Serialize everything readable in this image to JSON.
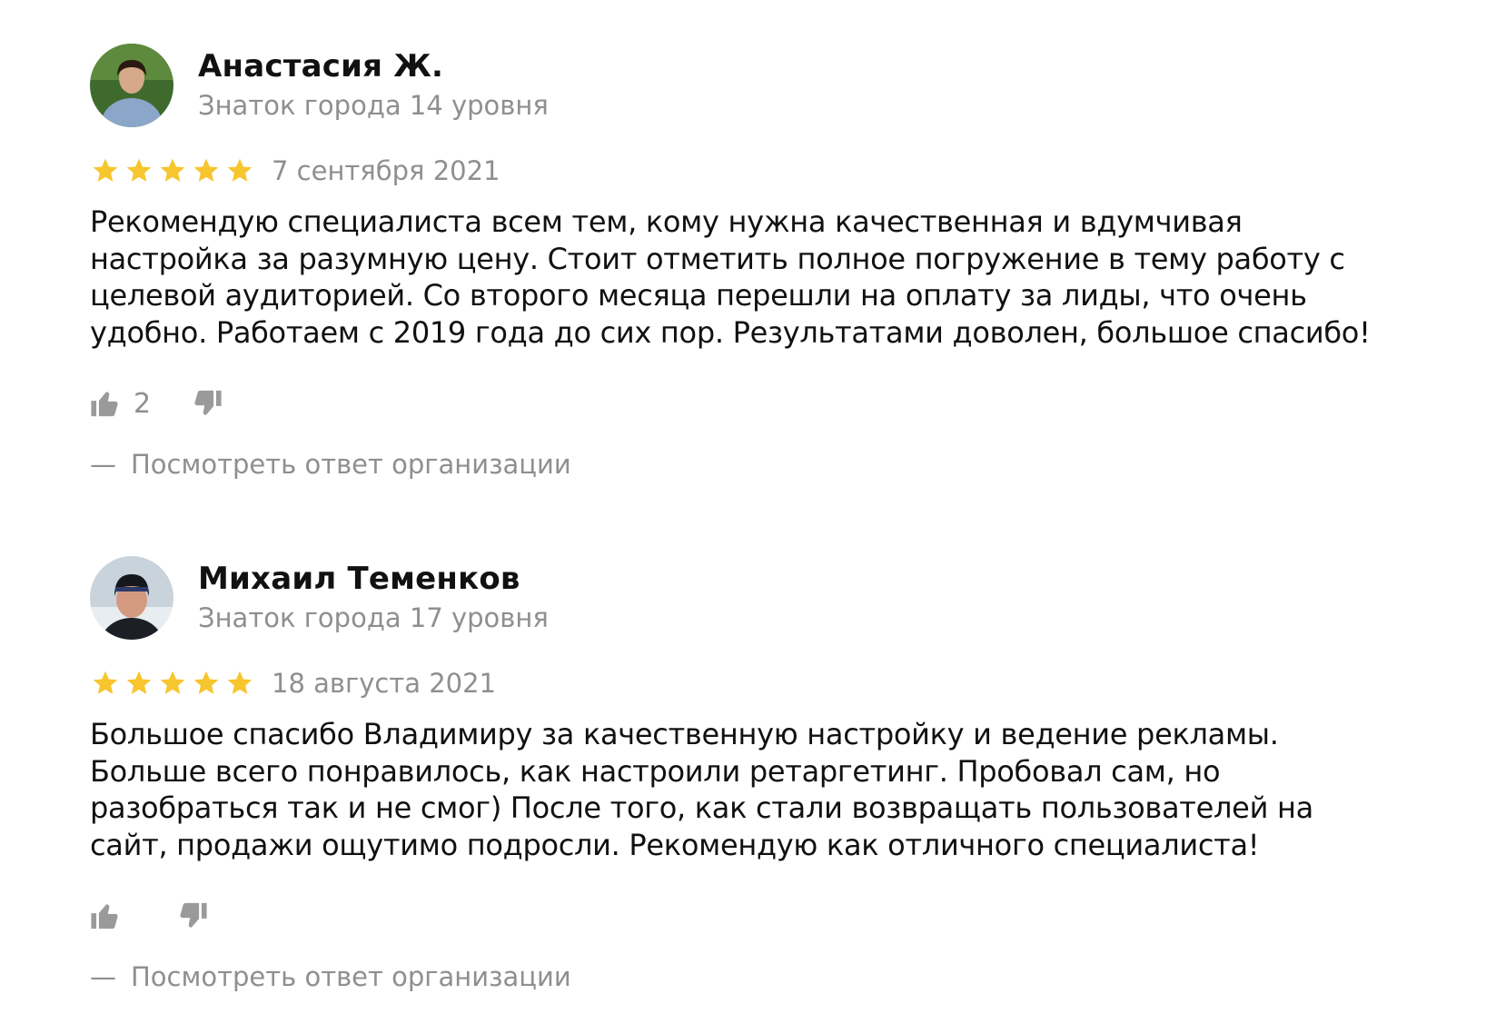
{
  "reviews": [
    {
      "author": "Анастасия Ж.",
      "level": "Знаток города 14 уровня",
      "rating": 5,
      "date": "7 сентября 2021",
      "text": "Рекомендую специалиста всем тем, кому нужна качественная и вдумчивая\nнастройка за разумную цену. Стоит отметить полное погружение в тему работу с\nцелевой аудиторией. Со второго месяца перешли на оплату за лиды, что очень\nудобно. Работаем с 2019 года до сих пор. Результатами доволен, большое спасибо!",
      "likes": "2",
      "dash": "—",
      "org_answer": "Посмотреть ответ организации"
    },
    {
      "author": "Михаил Теменков",
      "level": "Знаток города 17 уровня",
      "rating": 5,
      "date": "18 августа 2021",
      "text": "Большое спасибо Владимиру за качественную настройку и ведение рекламы.\nБольше всего понравилось, как настроили ретаргетинг. Пробовал сам, но\nразобраться так и не смог) После того, как стали возвращать пользователей на\nсайт, продажи ощутимо подросли. Рекомендую как отличного специалиста!",
      "likes": "",
      "dash": "—",
      "org_answer": "Посмотреть ответ организации"
    }
  ],
  "colors": {
    "star": "#f7c52d",
    "muted": "#8f8f8f",
    "text": "#111111",
    "icon": "#9a9a9a"
  }
}
